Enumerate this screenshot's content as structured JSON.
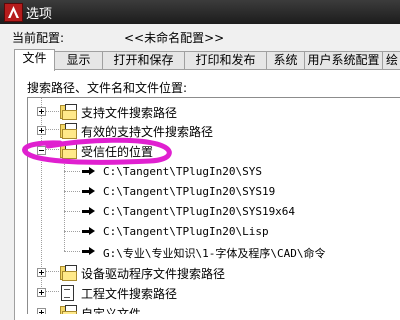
{
  "window": {
    "title": "选项",
    "app_icon": "autocad-icon"
  },
  "profile": {
    "label": "当前配置:",
    "value": "<<未命名配置>>"
  },
  "tabs": [
    {
      "label": "文件",
      "active": true
    },
    {
      "label": "显示",
      "active": false
    },
    {
      "label": "打开和保存",
      "active": false
    },
    {
      "label": "打印和发布",
      "active": false
    },
    {
      "label": "系统",
      "active": false
    },
    {
      "label": "用户系统配置",
      "active": false
    },
    {
      "label": "绘",
      "active": false
    }
  ],
  "section_label": "搜索路径、文件名和文件位置:",
  "tree": {
    "items": [
      {
        "label": "支持文件搜索路径",
        "icon": "folder-icon",
        "expanded": false
      },
      {
        "label": "有效的支持文件搜索路径",
        "icon": "folder-icon",
        "expanded": false
      },
      {
        "label": "受信任的位置",
        "icon": "folder-icon",
        "expanded": true
      },
      {
        "label": "设备驱动程序文件搜索路径",
        "icon": "folder-icon",
        "expanded": false
      },
      {
        "label": "工程文件搜索路径",
        "icon": "document-icon",
        "expanded": false
      },
      {
        "label": "自定义文件",
        "icon": "folder-icon",
        "expanded": false
      }
    ],
    "trusted_paths": [
      "C:\\Tangent\\TPlugIn20\\SYS",
      "C:\\Tangent\\TPlugIn20\\SYS19",
      "C:\\Tangent\\TPlugIn20\\SYS19x64",
      "C:\\Tangent\\TPlugIn20\\Lisp",
      "G:\\专业\\专业知识\\1-字体及程序\\CAD\\命令"
    ]
  },
  "highlight_color": "#e020d0"
}
